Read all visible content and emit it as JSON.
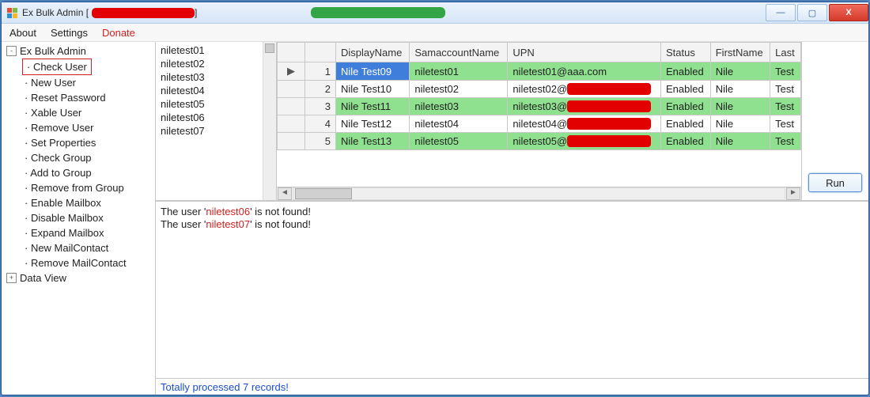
{
  "window": {
    "title_prefix": "Ex Bulk Admin [",
    "title_suffix": "]"
  },
  "win_controls": {
    "minimize": "—",
    "maximize": "▢",
    "close": "X"
  },
  "menubar": {
    "about": "About",
    "settings": "Settings",
    "donate": "Donate"
  },
  "tree": {
    "root": "Ex Bulk Admin",
    "expand_minus": "-",
    "expand_plus": "+",
    "items": [
      "Check User",
      "New User",
      "Reset Password",
      "Xable User",
      "Remove User",
      "Set Properties",
      "Check Group",
      "Add to Group",
      "Remove from Group",
      "Enable Mailbox",
      "Disable Mailbox",
      "Expand Mailbox",
      "New MailContact",
      "Remove MailContact"
    ],
    "data_view": "Data View"
  },
  "userlist": [
    "niletest01",
    "niletest02",
    "niletest03",
    "niletest04",
    "niletest05",
    "niletest06",
    "niletest07"
  ],
  "grid": {
    "row_pointer": "▶",
    "columns": [
      "DisplayName",
      "SamaccountName",
      "UPN",
      "Status",
      "FirstName",
      "Last"
    ],
    "rows": [
      {
        "n": "1",
        "display": "Nile Test09",
        "sam": "niletest01",
        "upn_text": "niletest01@aaa.com",
        "upn_red": false,
        "status": "Enabled",
        "first": "Nile",
        "last": "Test"
      },
      {
        "n": "2",
        "display": "Nile Test10",
        "sam": "niletest02",
        "upn_text": "niletest02@",
        "upn_red": true,
        "status": "Enabled",
        "first": "Nile",
        "last": "Test"
      },
      {
        "n": "3",
        "display": "Nile Test11",
        "sam": "niletest03",
        "upn_text": "niletest03@",
        "upn_red": true,
        "status": "Enabled",
        "first": "Nile",
        "last": "Test"
      },
      {
        "n": "4",
        "display": "Nile Test12",
        "sam": "niletest04",
        "upn_text": "niletest04@",
        "upn_red": true,
        "status": "Enabled",
        "first": "Nile",
        "last": "Test"
      },
      {
        "n": "5",
        "display": "Nile Test13",
        "sam": "niletest05",
        "upn_text": "niletest05@",
        "upn_red": true,
        "status": "Enabled",
        "first": "Nile",
        "last": "Test"
      }
    ]
  },
  "run_button": "Run",
  "output": {
    "prefix": "The user '",
    "suffix": "' is not found!",
    "lines": [
      "niletest06",
      "niletest07"
    ]
  },
  "statusbar": "Totally processed 7 records!"
}
